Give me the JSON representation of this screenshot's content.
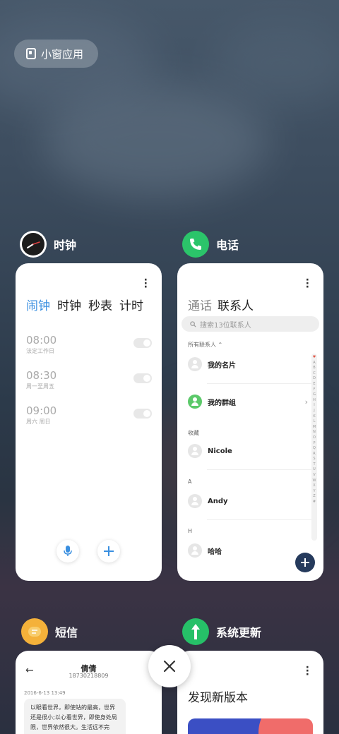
{
  "floating": {
    "label": "小窗应用"
  },
  "apps": {
    "clock": {
      "title": "时钟",
      "tabs": [
        "闹钟",
        "时钟",
        "秒表",
        "计时"
      ],
      "alarms": [
        {
          "time": "08:00",
          "repeat": "法定工作日"
        },
        {
          "time": "08:30",
          "repeat": "周一至周五"
        },
        {
          "time": "09:00",
          "repeat": "周六 周日"
        }
      ]
    },
    "phone": {
      "title": "电话",
      "tabs": [
        "通话",
        "联系人"
      ],
      "search_placeholder": "搜索13位联系人",
      "filter": "所有联系人",
      "my_card": "我的名片",
      "my_groups": "我的群组",
      "sections": [
        {
          "label": "收藏",
          "contact": "Nicole"
        },
        {
          "label": "A",
          "contact": "Andy"
        },
        {
          "label": "H",
          "contact": "哈哈"
        }
      ],
      "index_letters": [
        "♥",
        "A",
        "B",
        "C",
        "D",
        "E",
        "F",
        "G",
        "H",
        "I",
        "J",
        "K",
        "L",
        "M",
        "N",
        "O",
        "P",
        "Q",
        "R",
        "S",
        "T",
        "U",
        "V",
        "W",
        "X",
        "Y",
        "Z",
        "#"
      ]
    },
    "sms": {
      "title": "短信",
      "contact_name": "倩倩",
      "contact_number": "18730218809",
      "timestamp": "2016-6-13 13:49",
      "message": "以眼看世界，即使站的最高，世界还是很小;以心看世界，即使身处局限，世界依然很大。生活远不完美，需要用心去体会;无需拥有太多，需"
    },
    "update": {
      "title": "系统更新",
      "heading": "发现新版本"
    }
  },
  "colors": {
    "clock_accent": "#3a8fe0",
    "phone_icon": "#2bc46a",
    "sms_icon": "#f4b13a",
    "update_icon": "#26c068",
    "fab": "#253a5c"
  }
}
